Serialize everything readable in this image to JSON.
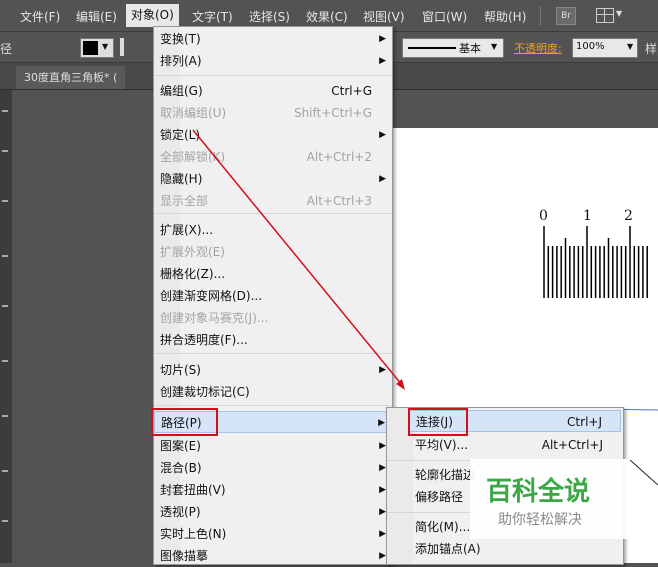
{
  "menubar": {
    "items": [
      "文件(F)",
      "编辑(E)",
      "对象(O)",
      "文字(T)",
      "选择(S)",
      "效果(C)",
      "视图(V)",
      "窗口(W)",
      "帮助(H)"
    ],
    "bridge": "Br"
  },
  "control_bar": {
    "left_label": "径",
    "stroke_style": "基本",
    "opacity_label": "不透明度:",
    "opacity_value": "100%",
    "right_label": "样"
  },
  "document_tab": {
    "title": "30度直角三角板* ("
  },
  "object_menu": {
    "items": [
      {
        "label": "变换(T)",
        "shortcut": "",
        "submenu": true,
        "disabled": false
      },
      {
        "label": "排列(A)",
        "shortcut": "",
        "submenu": true,
        "disabled": false
      },
      {
        "label": "编组(G)",
        "shortcut": "Ctrl+G",
        "submenu": false,
        "disabled": false
      },
      {
        "label": "取消编组(U)",
        "shortcut": "Shift+Ctrl+G",
        "submenu": false,
        "disabled": true
      },
      {
        "label": "锁定(L)",
        "shortcut": "",
        "submenu": true,
        "disabled": false
      },
      {
        "label": "全部解锁(K)",
        "shortcut": "Alt+Ctrl+2",
        "submenu": false,
        "disabled": true
      },
      {
        "label": "隐藏(H)",
        "shortcut": "",
        "submenu": true,
        "disabled": false
      },
      {
        "label": "显示全部",
        "shortcut": "Alt+Ctrl+3",
        "submenu": false,
        "disabled": true
      },
      {
        "label": "扩展(X)...",
        "shortcut": "",
        "submenu": false,
        "disabled": false
      },
      {
        "label": "扩展外观(E)",
        "shortcut": "",
        "submenu": false,
        "disabled": true
      },
      {
        "label": "栅格化(Z)...",
        "shortcut": "",
        "submenu": false,
        "disabled": false
      },
      {
        "label": "创建渐变网格(D)...",
        "shortcut": "",
        "submenu": false,
        "disabled": false
      },
      {
        "label": "创建对象马赛克(J)...",
        "shortcut": "",
        "submenu": false,
        "disabled": true
      },
      {
        "label": "拼合透明度(F)...",
        "shortcut": "",
        "submenu": false,
        "disabled": false
      },
      {
        "label": "切片(S)",
        "shortcut": "",
        "submenu": true,
        "disabled": false
      },
      {
        "label": "创建裁切标记(C)",
        "shortcut": "",
        "submenu": false,
        "disabled": false
      },
      {
        "label": "路径(P)",
        "shortcut": "",
        "submenu": true,
        "disabled": false
      },
      {
        "label": "图案(E)",
        "shortcut": "",
        "submenu": true,
        "disabled": false
      },
      {
        "label": "混合(B)",
        "shortcut": "",
        "submenu": true,
        "disabled": false
      },
      {
        "label": "封套扭曲(V)",
        "shortcut": "",
        "submenu": true,
        "disabled": false
      },
      {
        "label": "透视(P)",
        "shortcut": "",
        "submenu": true,
        "disabled": false
      },
      {
        "label": "实时上色(N)",
        "shortcut": "",
        "submenu": true,
        "disabled": false
      },
      {
        "label": "图像描摹",
        "shortcut": "",
        "submenu": true,
        "disabled": false
      }
    ]
  },
  "path_submenu": {
    "items": [
      {
        "label": "连接(J)",
        "shortcut": "Ctrl+J"
      },
      {
        "label": "平均(V)...",
        "shortcut": "Alt+Ctrl+J"
      },
      {
        "label": "轮廓化描边",
        "shortcut": ""
      },
      {
        "label": "偏移路径",
        "shortcut": ""
      },
      {
        "label": "简化(M)...",
        "shortcut": ""
      },
      {
        "label": "添加锚点(A)",
        "shortcut": ""
      }
    ]
  },
  "ruler": {
    "labels": [
      "0",
      "1",
      "2"
    ]
  },
  "watermark": {
    "title": "百科全说",
    "subtitle": "助你轻松解决"
  },
  "colors": {
    "accent_red": "#d0111b",
    "highlight": "#d5e4f7",
    "watermark_green": "#3aa845"
  }
}
